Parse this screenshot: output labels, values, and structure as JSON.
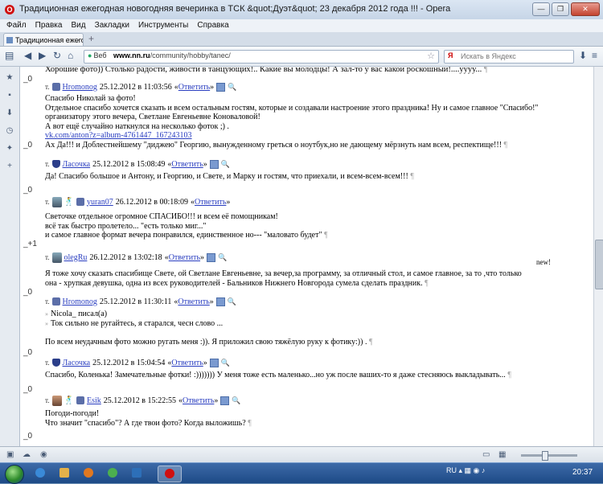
{
  "window": {
    "title": "Традиционная ежегодная новогодняя вечеринка в ТСК &quot;Дуэт&quot; 23 декабря 2012 года !!! - Opera",
    "controls": {
      "minimize": "—",
      "maximize": "❐",
      "close": "✕"
    }
  },
  "menu": [
    "Файл",
    "Правка",
    "Вид",
    "Закладки",
    "Инструменты",
    "Справка"
  ],
  "tab": {
    "label": "Традиционная ежегод...",
    "close": "×",
    "new_tab": "+"
  },
  "address": {
    "engine": "Веб",
    "url_host": "www.nn.ru",
    "url_path": "/community/hobby/tanec/",
    "search_placeholder": "Искать в Яндекс",
    "search_engine": "Я"
  },
  "posts": [
    {
      "score": "_0",
      "lines": [
        "Хорошие фото)) Столько радости, живости в танцующих!.. Какие вы молодцы! А зал-то у вас какой роскошный!....уууу..."
      ]
    },
    {
      "score": "_0",
      "author": "Hromonog",
      "date": "25.12.2012 в 11:03:56",
      "lines": [
        "Спасибо Николай за фото!",
        "Отдельное спасибо хочется сказать и всем остальным гостям, которые и создавали настроение этого праздника! Ну и самое главное \"Спасибо!\"",
        "организатору этого вечера, Светлане Евгеньевне Коноваловой!",
        "А вот ещё случайно наткнулся на несколько фоток ;) .",
        "vk.com/anton?z=album-4761447_167243103",
        "Ах Да!!! и Доблестнейшему \"диджею\" Георгию, вынужденному греться о ноутбук,но не дающему мёрзнуть нам всем, респектище!!!"
      ]
    },
    {
      "score": "_0",
      "author": "Ласочка",
      "date": "25.12.2012 в 15:08:49",
      "lines": [
        "Да! Спасибо большое и Антону, и Георгию, и Свете, и Марку и гостям, что приехали, и всем-всем-всем!!!"
      ]
    },
    {
      "score": "_+1",
      "author": "yuran07",
      "date": "26.12.2012 в 00:18:09",
      "lines": [
        "Светочке отдельное огромное СПАСИБО!!! и всем её помощникам!",
        "всё так быстро пролетело... \"есть только миг...\"",
        "и самое главное формат вечера понравился, единственное но--- \"маловато будет\""
      ]
    },
    {
      "score": "_0",
      "author": "olegRu",
      "date": "26.12.2012 в 13:02:18",
      "new": "new!",
      "lines": [
        "Я тоже хочу сказать спасибище Свете, ой Светлане Евгеньевне, за вечер,за программу, за отличный стол, и самое главное, за то ,что только",
        "она - хрупкая девушка, одна из всех руководителей - Бальников Нижнего Новгорода сумела сделать праздник."
      ]
    },
    {
      "score": "_0",
      "author": "Hromonog",
      "date": "25.12.2012 в 11:30:11",
      "quote": [
        "Nicola_ писал(а)",
        "Ток сильно не ругайтесь, я старался, чесн слово ..."
      ],
      "lines": [
        "По всем неудачным фото можно ругать меня :)). Я приложил свою тяжёлую руку к фотику:)) ."
      ]
    },
    {
      "score": "_0",
      "author": "Ласочка",
      "date": "25.12.2012 в 15:04:54",
      "lines": [
        "Спасибо, Коленька! Замечательные фотки! :))))))) У меня тоже есть маленько...но уж после ваших-то я даже стесняюсь выкладывать..."
      ]
    },
    {
      "score": "_0",
      "author": "Esik",
      "date": "25.12.2012 в 15:22:55",
      "lines": [
        "Погоди-погоди!",
        "Что значит \"спасибо\"? А где твои фото? Когда выложишь?"
      ]
    }
  ],
  "reply_label": "Ответить",
  "reply_open": "«",
  "reply_close": "»",
  "thread_marker": "т.",
  "pilcrow": "¶",
  "taskbar": {
    "lang": "RU",
    "time": "20:37"
  },
  "colors": {
    "link": "#2a3ec0",
    "accent": "#d01010"
  }
}
